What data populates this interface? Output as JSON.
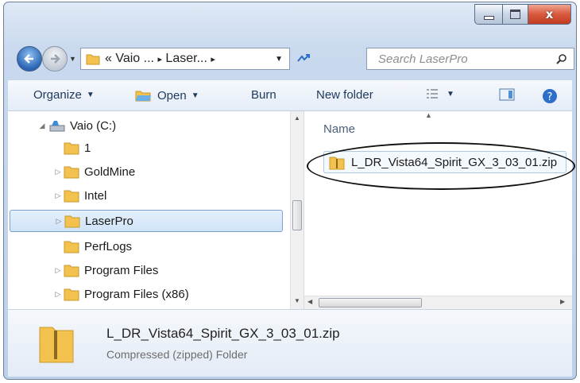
{
  "window": {
    "controls": {
      "minimize": "minimize",
      "maximize": "maximize",
      "close": "x"
    }
  },
  "address": {
    "prefix": "«",
    "path": [
      "Vaio ...",
      "Laser..."
    ],
    "separator": "▸"
  },
  "search": {
    "placeholder": "Search LaserPro"
  },
  "toolbar": {
    "organize": "Organize",
    "open": "Open",
    "burn": "Burn",
    "new_folder": "New folder"
  },
  "tree": {
    "items": [
      {
        "label": "Vaio (C:)",
        "icon": "drive-icon",
        "expander": "◢"
      },
      {
        "label": "1",
        "icon": "folder-icon",
        "expander": ""
      },
      {
        "label": "GoldMine",
        "icon": "folder-icon",
        "expander": "▷"
      },
      {
        "label": "Intel",
        "icon": "folder-icon",
        "expander": "▷"
      },
      {
        "label": "LaserPro",
        "icon": "folder-icon",
        "expander": "▷",
        "selected": true
      },
      {
        "label": "PerfLogs",
        "icon": "folder-icon",
        "expander": ""
      },
      {
        "label": "Program Files",
        "icon": "folder-icon",
        "expander": "▷"
      },
      {
        "label": "Program Files (x86)",
        "icon": "folder-icon",
        "expander": "▷"
      }
    ]
  },
  "list": {
    "column_name": "Name",
    "files": [
      {
        "name": "L_DR_Vista64_Spirit_GX_3_03_01.zip",
        "icon": "zip-folder-icon"
      }
    ]
  },
  "details": {
    "name": "L_DR_Vista64_Spirit_GX_3_03_01.zip",
    "type": "Compressed (zipped) Folder"
  },
  "colors": {
    "accent": "#2d6fc8",
    "folder": "#f2c14e",
    "close": "#c94a2c"
  }
}
